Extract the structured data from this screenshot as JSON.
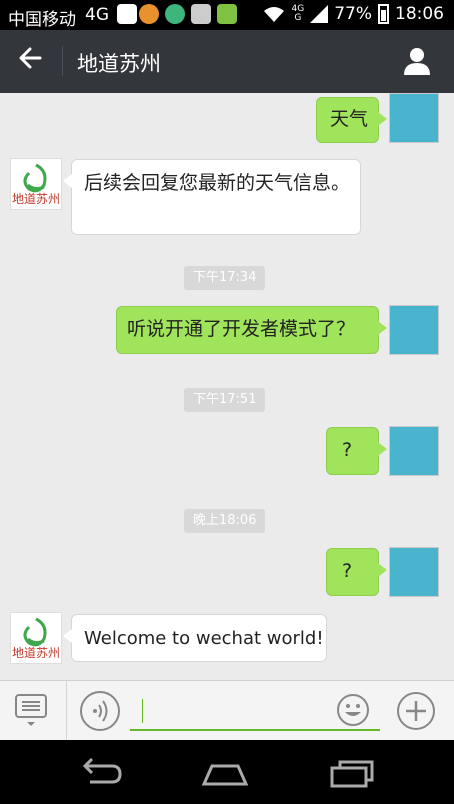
{
  "status_bar": {
    "carrier": "中国移动",
    "network": "4G",
    "signal_label_top": "4G",
    "signal_label_bottom": "G",
    "battery": "77%",
    "time": "18:06"
  },
  "app_bar": {
    "title": "地道苏州"
  },
  "official_account": {
    "logo_text": "地道苏州"
  },
  "messages": [
    {
      "type": "outgoing",
      "text": "天气"
    },
    {
      "type": "incoming",
      "text": "后续会回复您最新的天气信息。"
    },
    {
      "type": "timestamp",
      "text": "下午17:34"
    },
    {
      "type": "outgoing",
      "text": "听说开通了开发者模式了？"
    },
    {
      "type": "timestamp",
      "text": "下午17:51"
    },
    {
      "type": "outgoing",
      "text": "?"
    },
    {
      "type": "timestamp",
      "text": "晚上18:06"
    },
    {
      "type": "outgoing",
      "text": "?"
    },
    {
      "type": "incoming",
      "text": "Welcome to wechat world!"
    }
  ],
  "input_bar": {
    "text_value": "",
    "icons": [
      "menu-list-icon",
      "voice-icon",
      "emoji-icon",
      "plus-icon"
    ]
  },
  "nav_bar": {
    "icons": [
      "back-icon",
      "home-icon",
      "recents-icon"
    ]
  },
  "colors": {
    "app_bar": "#33363b",
    "chat_bg": "#ebebeb",
    "outgoing_bubble": "#9fe45b",
    "incoming_bubble": "#ffffff",
    "avatar": "#4ab3cd",
    "accent_green": "#66b82a"
  }
}
